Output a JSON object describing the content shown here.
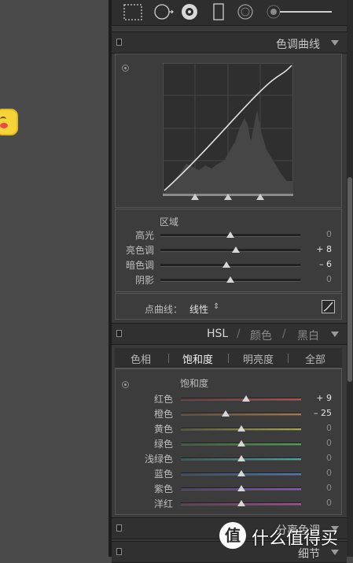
{
  "toolbar": {
    "tools": [
      "crop-tool",
      "spot-removal-tool",
      "red-eye-tool",
      "graduated-filter-tool",
      "radial-filter-tool",
      "adjustment-brush-tool"
    ]
  },
  "tone_curve": {
    "title": "色调曲线",
    "region_label": "区域",
    "sliders": [
      {
        "label": "高光",
        "value": "0",
        "level": 0
      },
      {
        "label": "亮色调",
        "value": "+ 8",
        "level": 8
      },
      {
        "label": "暗色调",
        "value": "– 6",
        "level": -6
      },
      {
        "label": "阴影",
        "value": "0",
        "level": 0
      }
    ],
    "point_curve_label": "点曲线：",
    "point_curve_value": "线性",
    "point_curve_arrows": "⇕"
  },
  "hsl": {
    "title_hsl": "HSL",
    "title_color": "颜色",
    "title_bw": "黑白",
    "slash": "/",
    "tabs": [
      "色相",
      "饱和度",
      "明亮度",
      "全部"
    ],
    "active_tab": "饱和度",
    "group_label": "饱和度",
    "sliders": [
      {
        "label": "红色",
        "value": "+ 9",
        "level": 9,
        "grad": [
          "#5a3a3a",
          "#b05050"
        ]
      },
      {
        "label": "橙色",
        "value": "– 25",
        "level": -25,
        "grad": [
          "#5a4a3a",
          "#b07a40"
        ]
      },
      {
        "label": "黄色",
        "value": "0",
        "level": 0,
        "grad": [
          "#58583a",
          "#a8a844"
        ]
      },
      {
        "label": "绿色",
        "value": "0",
        "level": 0,
        "grad": [
          "#3e5a3e",
          "#4ea44e"
        ]
      },
      {
        "label": "浅绿色",
        "value": "0",
        "level": 0,
        "grad": [
          "#3a5858",
          "#48a8a0"
        ]
      },
      {
        "label": "蓝色",
        "value": "0",
        "level": 0,
        "grad": [
          "#3a4a5e",
          "#4a78c8"
        ]
      },
      {
        "label": "紫色",
        "value": "0",
        "level": 0,
        "grad": [
          "#4e3e5e",
          "#8a5ac0"
        ]
      },
      {
        "label": "洋红",
        "value": "0",
        "level": 0,
        "grad": [
          "#5a3a52",
          "#b048a0"
        ]
      }
    ]
  },
  "split_toning": {
    "title": "分离色调"
  },
  "detail": {
    "title": "细节"
  },
  "watermark": {
    "text": "什么值得买"
  },
  "colors": {
    "panel_bg": "#393939",
    "header_bg": "#303030",
    "accent_text": "#c6c6c6"
  }
}
